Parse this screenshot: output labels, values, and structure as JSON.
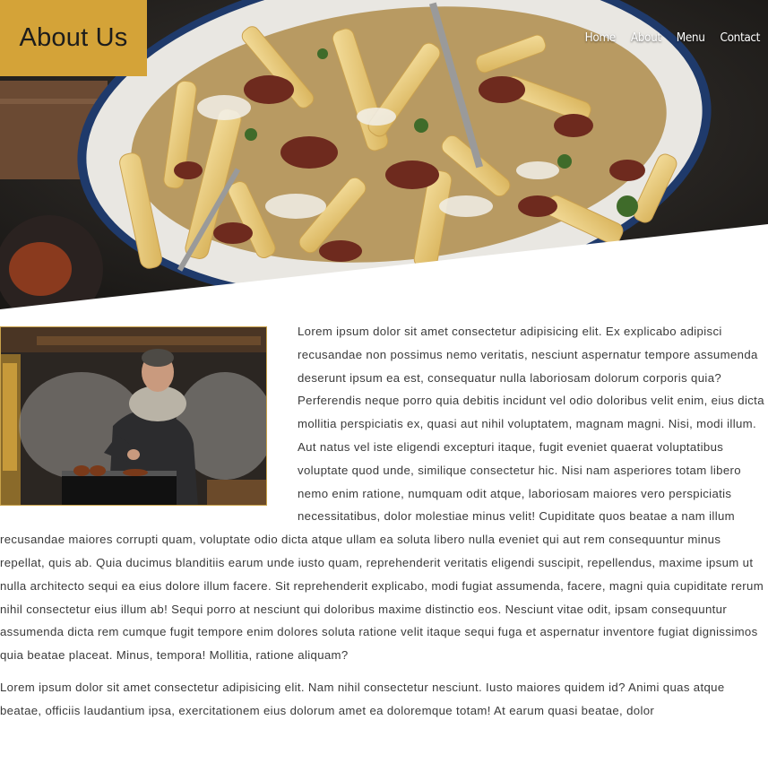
{
  "header": {
    "title": "About Us",
    "nav": [
      {
        "label": "Home"
      },
      {
        "label": "About"
      },
      {
        "label": "Menu"
      },
      {
        "label": "Contact"
      }
    ]
  },
  "colors": {
    "accent": "#d4a338",
    "text": "#3a3a3a",
    "nav_text": "#ffffff"
  },
  "images": {
    "hero": "fries-dish-icon",
    "chef": "chef-grilling-icon"
  },
  "content": {
    "paragraph_1": "Lorem ipsum dolor sit amet consectetur adipisicing elit. Ex explicabo adipisci recusandae non possimus nemo veritatis, nesciunt aspernatur tempore assumenda deserunt ipsum ea est, consequatur nulla laboriosam dolorum corporis quia? Perferendis neque porro quia debitis incidunt vel odio doloribus velit enim, eius dicta mollitia perspiciatis ex, quasi aut nihil voluptatem, magnam magni. Nisi, modi illum. Aut natus vel iste eligendi excepturi itaque, fugit eveniet quaerat voluptatibus voluptate quod unde, similique consectetur hic. Nisi nam asperiores totam libero nemo enim ratione, numquam odit atque, laboriosam maiores vero perspiciatis necessitatibus, dolor molestiae minus velit! Cupiditate quos beatae a nam illum recusandae maiores corrupti quam, voluptate odio dicta atque ullam ea soluta libero nulla eveniet qui aut rem consequuntur minus repellat, quis ab. Quia ducimus blanditiis earum unde iusto quam, reprehenderit veritatis eligendi suscipit, repellendus, maxime ipsum ut nulla architecto sequi ea eius dolore illum facere. Sit reprehenderit explicabo, modi fugiat assumenda, facere, magni quia cupiditate rerum nihil consectetur eius illum ab! Sequi porro at nesciunt qui doloribus maxime distinctio eos. Nesciunt vitae odit, ipsam consequuntur assumenda dicta rem cumque fugit tempore enim dolores soluta ratione velit itaque sequi fuga et aspernatur inventore fugiat dignissimos quia beatae placeat. Minus, tempora! Mollitia, ratione aliquam?",
    "paragraph_2": "Lorem ipsum dolor sit amet consectetur adipisicing elit. Nam nihil consectetur nesciunt. Iusto maiores quidem id? Animi quas atque beatae, officiis laudantium ipsa, exercitationem eius dolorum amet ea doloremque totam! At earum quasi beatae, dolor"
  }
}
